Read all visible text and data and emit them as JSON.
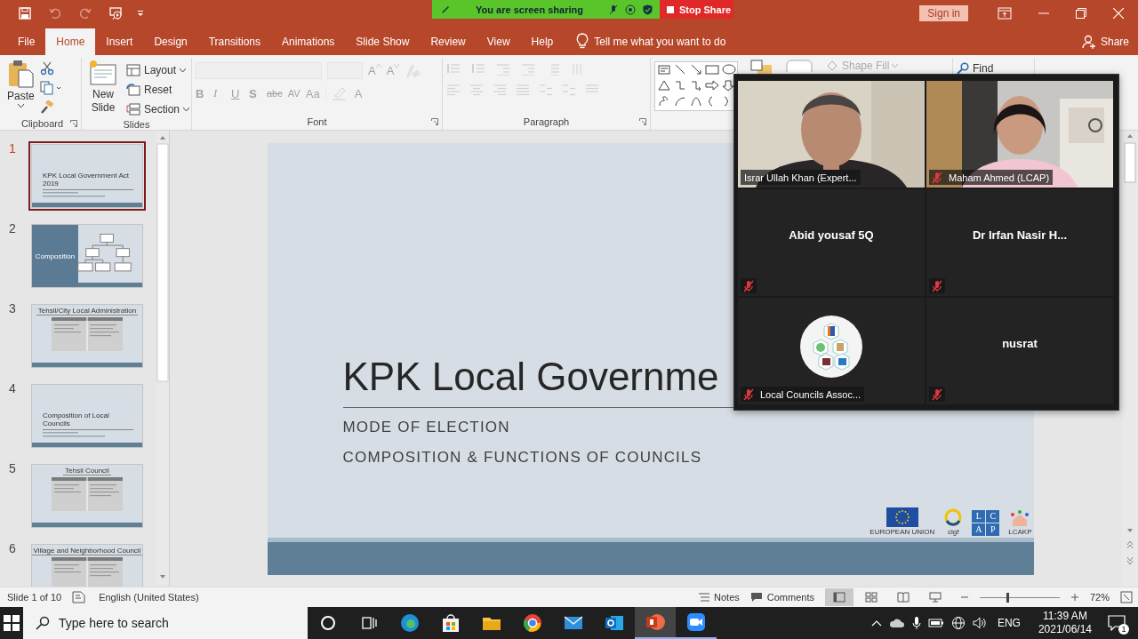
{
  "quick_access": [
    {
      "disabled": false
    },
    {
      "disabled": true
    },
    {
      "disabled": true
    },
    {
      "disabled": false
    }
  ],
  "screen_share": {
    "status": "You are screen sharing",
    "stop": "Stop Share"
  },
  "sign_in": "Sign in",
  "tabs": [
    {
      "label": "File",
      "selected": false
    },
    {
      "label": "Home",
      "selected": true
    },
    {
      "label": "Insert",
      "selected": false
    },
    {
      "label": "Design",
      "selected": false
    },
    {
      "label": "Transitions",
      "selected": false
    },
    {
      "label": "Animations",
      "selected": false
    },
    {
      "label": "Slide Show",
      "selected": false
    },
    {
      "label": "Review",
      "selected": false
    },
    {
      "label": "View",
      "selected": false
    },
    {
      "label": "Help",
      "selected": false
    }
  ],
  "tell_me": "Tell me what you want to do",
  "share": "Share",
  "ribbon": {
    "clipboard": {
      "label": "Clipboard",
      "paste": "Paste"
    },
    "slides": {
      "label": "Slides",
      "new_slide": "New Slide",
      "layout": "Layout",
      "reset": "Reset",
      "section": "Section"
    },
    "font": {
      "label": "Font",
      "disabled": true,
      "top_buttons": [
        {
          "text": "A",
          "kind": "grow"
        },
        {
          "text": "A",
          "kind": "shrink"
        }
      ],
      "buttons": [
        {
          "text": "B",
          "kind": "bold"
        },
        {
          "text": "I",
          "kind": "italic"
        },
        {
          "text": "U",
          "kind": "underline"
        },
        {
          "text": "S",
          "kind": "shadow"
        },
        {
          "text": "abc",
          "kind": "strike"
        },
        {
          "text": "AV",
          "kind": "spacing"
        },
        {
          "text": "Aa",
          "kind": "case"
        }
      ],
      "color_button": "A"
    },
    "paragraph": {
      "label": "Paragraph",
      "disabled": true
    },
    "shape_fill": {
      "label": "Shape Fill",
      "disabled": true
    },
    "find": "Find"
  },
  "slides_pane": [
    {
      "number": "1",
      "title": "KPK Local Government Act 2019",
      "kind": "title",
      "selected": true
    },
    {
      "number": "2",
      "title": "Composition",
      "kind": "diagram",
      "selected": false
    },
    {
      "number": "3",
      "title": "Tehsil/City Local Administration",
      "kind": "table",
      "selected": false
    },
    {
      "number": "4",
      "title": "Composition of Local Councils",
      "kind": "title",
      "selected": false
    },
    {
      "number": "5",
      "title": "Tehsil Council",
      "kind": "table",
      "selected": false
    },
    {
      "number": "6",
      "title": "Village and Neighborhood Council",
      "kind": "table",
      "selected": false
    }
  ],
  "slide": {
    "title": "KPK Local Governme",
    "subtitles": [
      "MODE OF ELECTION",
      "COMPOSITION & FUNCTIONS OF COUNCILS"
    ],
    "logos": {
      "eu": "EUROPEAN UNION",
      "clgf": "clgf",
      "lcap": [
        "L",
        "C",
        "A",
        "P"
      ],
      "lcakp": "LCAKP"
    }
  },
  "meeting": {
    "participants": [
      {
        "name": "Israr Ullah Khan (Expert...",
        "kind": "video",
        "muted": false,
        "speaking": true
      },
      {
        "name": "Maham Ahmed (LCAP)",
        "kind": "video",
        "muted": true,
        "speaking": false
      },
      {
        "name": "Abid yousaf 5Q",
        "kind": "name",
        "muted": true,
        "speaking": false
      },
      {
        "name": "Dr Irfan Nasir H...",
        "kind": "name",
        "muted": true,
        "speaking": false
      },
      {
        "name": "Local Councils Assoc...",
        "kind": "avatar",
        "muted": true,
        "speaking": false
      },
      {
        "name": "nusrat",
        "kind": "name",
        "muted": true,
        "speaking": false
      }
    ]
  },
  "status_bar": {
    "slide": "Slide 1 of 10",
    "language": "English (United States)",
    "notes": "Notes",
    "comments": "Comments",
    "views": [
      {
        "selected": true
      },
      {
        "selected": false
      },
      {
        "selected": false
      },
      {
        "selected": false
      }
    ],
    "zoom": {
      "level": 0.35,
      "reading": "72%"
    }
  },
  "taskbar": {
    "search_placeholder": "Type here to search",
    "apps": [
      {
        "selected": false,
        "running": false
      },
      {
        "selected": false,
        "running": false
      },
      {
        "selected": false,
        "running": false
      },
      {
        "selected": false,
        "running": false
      },
      {
        "selected": false,
        "running": false
      },
      {
        "selected": false,
        "running": false
      },
      {
        "selected": true,
        "running": true
      },
      {
        "selected": false,
        "running": true
      }
    ],
    "language": "ENG",
    "time": "11:39 AM",
    "date": "2021/06/14",
    "notifications": "1"
  }
}
